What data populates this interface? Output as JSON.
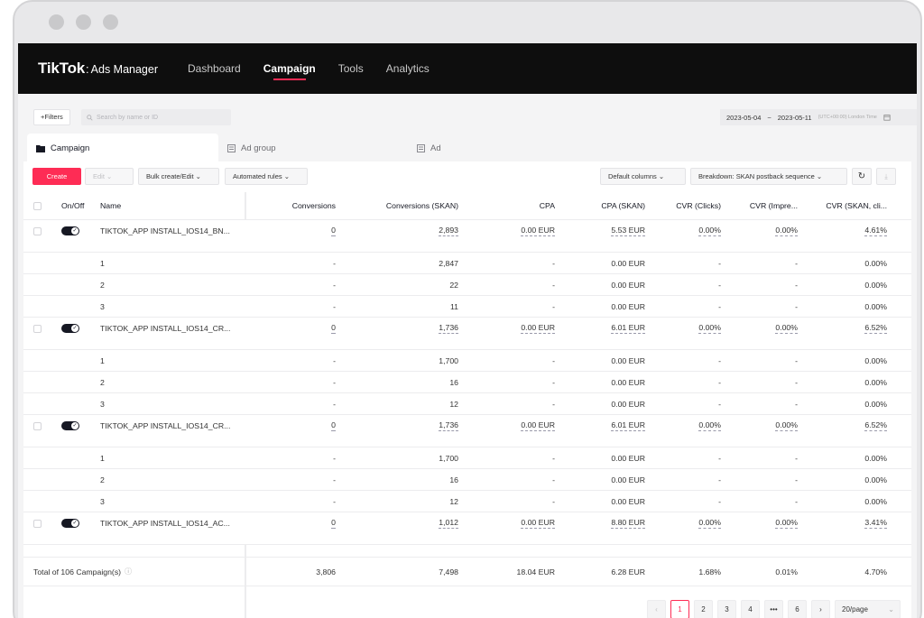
{
  "header": {
    "logo_main": "TikTok",
    "logo_dot": ":",
    "logo_sub": "Ads Manager",
    "nav": [
      "Dashboard",
      "Campaign",
      "Tools",
      "Analytics"
    ]
  },
  "filterbar": {
    "filters_label": "+Filters",
    "search_placeholder": "Search by name or ID",
    "date_start": "2023-05-04",
    "date_sep": "~",
    "date_end": "2023-05-11",
    "timezone": "(UTC+00:00) London Time"
  },
  "tabs": [
    "Campaign",
    "Ad group",
    "Ad"
  ],
  "toolbar": {
    "create": "Create",
    "edit": "Edit",
    "bulk": "Bulk create/Edit",
    "automated": "Automated rules",
    "columns": "Default columns",
    "breakdown": "Breakdown: SKAN postback sequence"
  },
  "columns": [
    "On/Off",
    "Name",
    "Conversions",
    "Conversions (SKAN)",
    "CPA",
    "CPA (SKAN)",
    "CVR (Clicks)",
    "CVR (Impre...",
    "CVR (SKAN, cli..."
  ],
  "campaigns": [
    {
      "name": "TIKTOK_APP INSTALL_IOS14_BN...",
      "conversions": "0",
      "skan": "2,893",
      "cpa": "0.00 EUR",
      "cpa_skan": "5.53 EUR",
      "cvr_clicks": "0.00%",
      "cvr_impr": "0.00%",
      "cvr_skan": "4.61%",
      "subs": [
        {
          "seq": "1",
          "conv": "-",
          "skan": "2,847",
          "cpa": "-",
          "cpa_skan": "0.00 EUR",
          "cvr_c": "-",
          "cvr_i": "-",
          "cvr_s": "0.00%"
        },
        {
          "seq": "2",
          "conv": "-",
          "skan": "22",
          "cpa": "-",
          "cpa_skan": "0.00 EUR",
          "cvr_c": "-",
          "cvr_i": "-",
          "cvr_s": "0.00%"
        },
        {
          "seq": "3",
          "conv": "-",
          "skan": "11",
          "cpa": "-",
          "cpa_skan": "0.00 EUR",
          "cvr_c": "-",
          "cvr_i": "-",
          "cvr_s": "0.00%"
        }
      ]
    },
    {
      "name": "TIKTOK_APP INSTALL_IOS14_CR...",
      "conversions": "0",
      "skan": "1,736",
      "cpa": "0.00 EUR",
      "cpa_skan": "6.01 EUR",
      "cvr_clicks": "0.00%",
      "cvr_impr": "0.00%",
      "cvr_skan": "6.52%",
      "subs": [
        {
          "seq": "1",
          "conv": "-",
          "skan": "1,700",
          "cpa": "-",
          "cpa_skan": "0.00 EUR",
          "cvr_c": "-",
          "cvr_i": "-",
          "cvr_s": "0.00%"
        },
        {
          "seq": "2",
          "conv": "-",
          "skan": "16",
          "cpa": "-",
          "cpa_skan": "0.00 EUR",
          "cvr_c": "-",
          "cvr_i": "-",
          "cvr_s": "0.00%"
        },
        {
          "seq": "3",
          "conv": "-",
          "skan": "12",
          "cpa": "-",
          "cpa_skan": "0.00 EUR",
          "cvr_c": "-",
          "cvr_i": "-",
          "cvr_s": "0.00%"
        }
      ]
    },
    {
      "name": "TIKTOK_APP INSTALL_IOS14_CR...",
      "conversions": "0",
      "skan": "1,736",
      "cpa": "0.00 EUR",
      "cpa_skan": "6.01 EUR",
      "cvr_clicks": "0.00%",
      "cvr_impr": "0.00%",
      "cvr_skan": "6.52%",
      "subs": [
        {
          "seq": "1",
          "conv": "-",
          "skan": "1,700",
          "cpa": "-",
          "cpa_skan": "0.00 EUR",
          "cvr_c": "-",
          "cvr_i": "-",
          "cvr_s": "0.00%"
        },
        {
          "seq": "2",
          "conv": "-",
          "skan": "16",
          "cpa": "-",
          "cpa_skan": "0.00 EUR",
          "cvr_c": "-",
          "cvr_i": "-",
          "cvr_s": "0.00%"
        },
        {
          "seq": "3",
          "conv": "-",
          "skan": "12",
          "cpa": "-",
          "cpa_skan": "0.00 EUR",
          "cvr_c": "-",
          "cvr_i": "-",
          "cvr_s": "0.00%"
        }
      ]
    },
    {
      "name": "TIKTOK_APP INSTALL_IOS14_AC...",
      "conversions": "0",
      "skan": "1,012",
      "cpa": "0.00 EUR",
      "cpa_skan": "8.80 EUR",
      "cvr_clicks": "0.00%",
      "cvr_impr": "0.00%",
      "cvr_skan": "3.41%",
      "subs": []
    }
  ],
  "total": {
    "label": "Total of 106 Campaign(s)",
    "conversions": "3,806",
    "skan": "7,498",
    "cpa": "18.04 EUR",
    "cpa_skan": "6.28 EUR",
    "cvr_clicks": "1.68%",
    "cvr_impr": "0.01%",
    "cvr_skan": "4.70%"
  },
  "pagination": {
    "prev": "‹",
    "pages": [
      "1",
      "2",
      "3",
      "4"
    ],
    "ellipsis": "•••",
    "last": "6",
    "next": "›",
    "page_size": "20/page"
  },
  "colors": {
    "accent": "#fe2c55",
    "header_bg": "#0e0e0e"
  }
}
